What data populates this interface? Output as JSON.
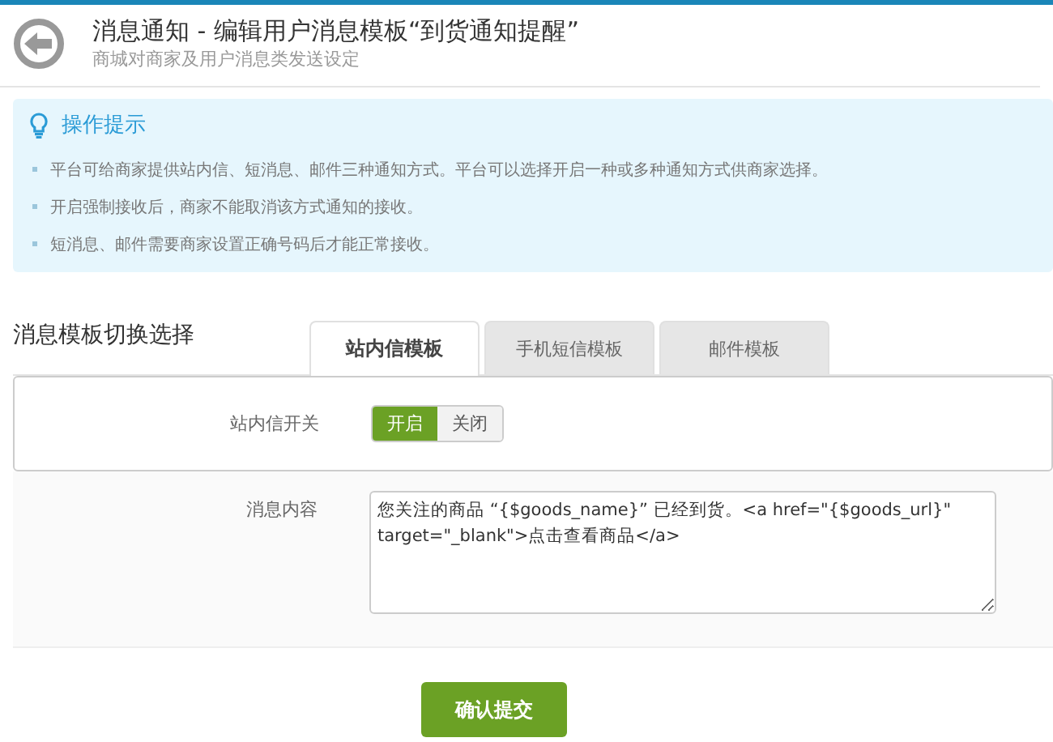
{
  "header": {
    "title": "消息通知 - 编辑用户消息模板“到货通知提醒”",
    "subtitle": "商城对商家及用户消息类发送设定"
  },
  "tips": {
    "title": "操作提示",
    "items": [
      "平台可给商家提供站内信、短消息、邮件三种通知方式。平台可以选择开启一种或多种通知方式供商家选择。",
      "开启强制接收后，商家不能取消该方式通知的接收。",
      "短消息、邮件需要商家设置正确号码后才能正常接收。"
    ]
  },
  "section": {
    "title": "消息模板切换选择"
  },
  "tabs": [
    {
      "label": "站内信模板",
      "selected": true
    },
    {
      "label": "手机短信模板",
      "selected": false
    },
    {
      "label": "邮件模板",
      "selected": false
    }
  ],
  "form": [
    {
      "kind": "switch",
      "label": "站内信开关",
      "options": [
        {
          "label": "开启",
          "selected": true
        },
        {
          "label": "关闭",
          "selected": false
        }
      ]
    },
    {
      "kind": "textarea",
      "label": "消息内容",
      "value": "您关注的商品 “{$goods_name}” 已经到货。<a href=\"{$goods_url}\" target=\"_blank\">点击查看商品</a>"
    }
  ],
  "submit": "确认提交"
}
